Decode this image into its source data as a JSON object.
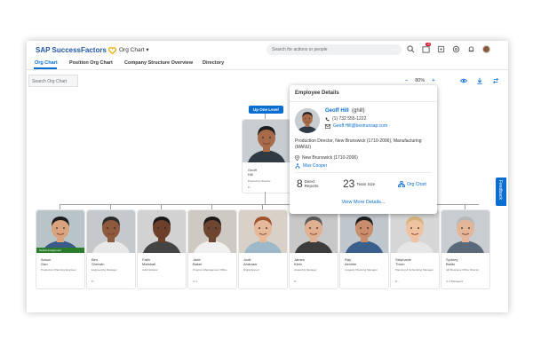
{
  "header": {
    "logo_text": "SAP SuccessFactors",
    "module_menu": "Org Chart ▾",
    "search_placeholder": "Search for actions or people",
    "notification_count": "18"
  },
  "tabs": [
    "Org Chart",
    "Position Org Chart",
    "Company Structure Overview",
    "Directory"
  ],
  "toolbar": {
    "search_chart_placeholder": "Search Org Chart",
    "zoom_out": "−",
    "zoom_level": "80%",
    "zoom_in": "+"
  },
  "up_level": "Up One Level",
  "top_card": {
    "name_line1": "Geoff",
    "name_line2": "Hill",
    "title": "Production Director",
    "count": "8 ›",
    "skin": "#a86b4a",
    "hair": "#1e1e1e",
    "shirt": "#2f3a45"
  },
  "reports": [
    {
      "first": "Anson",
      "last": "Gao",
      "title": "Production Planning Engineer",
      "count": "",
      "badge": "Global Assignment",
      "skin": "#d9a37d",
      "hair": "#1c1c1c",
      "shirt": "#3a5a8a",
      "bg": "#b9c4c8"
    },
    {
      "first": "Ben",
      "last": "Sherwin",
      "title": "Engineering Manager",
      "count": "8 ›",
      "badge": "",
      "skin": "#8d5a3e",
      "hair": "#2a2a2a",
      "shirt": "#e8e8e8",
      "bg": "#c6c9cc"
    },
    {
      "first": "Faith",
      "last": "Marshall",
      "title": "Administrator",
      "count": "",
      "badge": "",
      "skin": "#6b3f2a",
      "hair": "#1a1a1a",
      "shirt": "#444444",
      "bg": "#d2d2d2"
    },
    {
      "first": "Jade",
      "last": "Baker",
      "title": "Program Management Office",
      "count": "⊙ 1",
      "badge": "",
      "skin": "#6e4530",
      "hair": "#1a1a1a",
      "shirt": "#f0f0f0",
      "bg": "#cfc9c3"
    },
    {
      "first": "Judit",
      "last": "Andrasa",
      "title": "Digital Expert",
      "count": "",
      "badge": "",
      "skin": "#e8b89a",
      "hair": "#a0522d",
      "shirt": "#9db9c9",
      "bg": "#d9d1c7"
    },
    {
      "first": "James",
      "last": "Klein",
      "title": "Assembly Manager",
      "count": "8 ›",
      "badge": "",
      "skin": "#e0b090",
      "hair": "#5a5a5a",
      "shirt": "#3c3c3c",
      "bg": "#c8c8c8"
    },
    {
      "first": "Ray",
      "last": "Almhite",
      "title": "Capacity Planning Manager",
      "count": "",
      "badge": "",
      "skin": "#c98d6b",
      "hair": "#1e1e1e",
      "shirt": "#3b5f8c",
      "bg": "#bfc6cc"
    },
    {
      "first": "Stephanie",
      "last": "Thorn",
      "title": "Planning & Scheduling Manager",
      "count": "8 ›",
      "badge": "",
      "skin": "#efc3a2",
      "hair": "#d8b37a",
      "shirt": "#e6e6e6",
      "bg": "#d6d6d6"
    },
    {
      "first": "Sydney",
      "last": "Baldo",
      "title": "HR Business Office Director",
      "count": "⊙ 4 Managers",
      "badge": "",
      "skin": "#e5b597",
      "hair": "#b8b8b8",
      "shirt": "#5a6a7a",
      "bg": "#c9cdd1"
    }
  ],
  "popup": {
    "title": "Employee Details",
    "name": "Geoff Hill",
    "id": "(ghill)",
    "phone": "(1) 732 555-1222",
    "email": "Geoff.Hill@bestrunsap.com",
    "description": "Production Director, New Brunswick (1710-2006), Manufacturing (MANU)",
    "location": "New Brunswick (1710-2006)",
    "manager": "Max Cooper",
    "direct_reports_num": "8",
    "direct_reports_label1": "Direct",
    "direct_reports_label2": "Reports",
    "team_size_num": "23",
    "team_size_label": "Team Size",
    "org_chart_link": "Org Chart",
    "view_more": "View More Details..."
  },
  "feedback": "Feedback",
  "colors": {
    "brand_blue": "#0a6ed1",
    "sap_text_blue": "#1f56a8",
    "global_badge": "#2b7d2b",
    "notif_red": "#d0021b"
  }
}
